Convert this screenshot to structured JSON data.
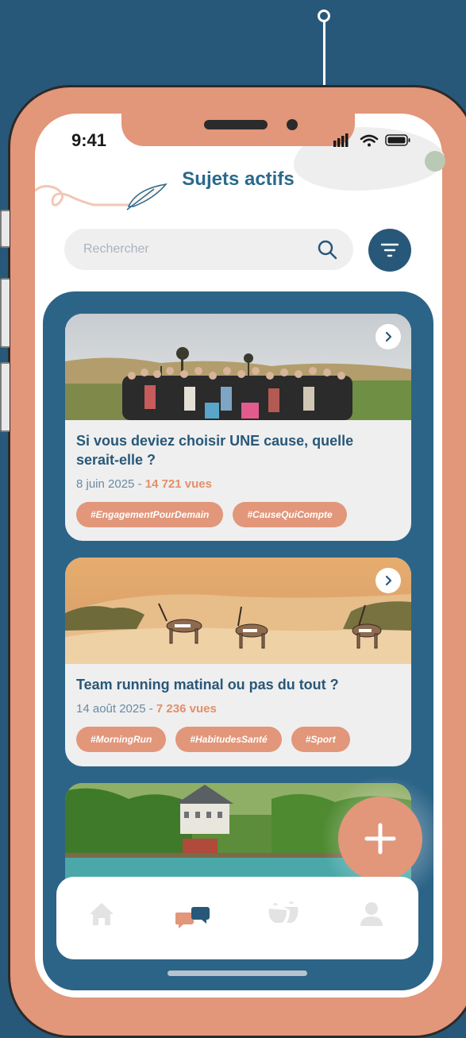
{
  "status_bar": {
    "time": "9:41"
  },
  "header": {
    "title": "Sujets actifs"
  },
  "search": {
    "placeholder": "Rechercher"
  },
  "topics": [
    {
      "title": "Si vous deviez choisir UNE cause, quelle serait-elle ?",
      "date": "8 juin 2025 - ",
      "views": "14 721 vues",
      "tags": [
        "#EngagementPourDemain",
        "#CauseQuiCompte"
      ]
    },
    {
      "title": "Team running matinal ou pas du tout ?",
      "date": "14 août 2025 - ",
      "views": "7 236 vues",
      "tags": [
        "#MorningRun",
        "#HabitudesSanté",
        "#Sport"
      ]
    }
  ],
  "icons": {
    "search": "search-icon",
    "filter": "filter-icon",
    "chevron": "chevron-right-icon",
    "add": "plus-icon",
    "tabs": [
      "home-icon",
      "chat-icon",
      "coffee-icon",
      "user-icon"
    ]
  },
  "colors": {
    "background": "#285879",
    "accent": "#e2967a",
    "primary": "#285879",
    "feed": "#2c6487",
    "card": "#efefef"
  },
  "tabbar": {
    "active_index": 1
  }
}
